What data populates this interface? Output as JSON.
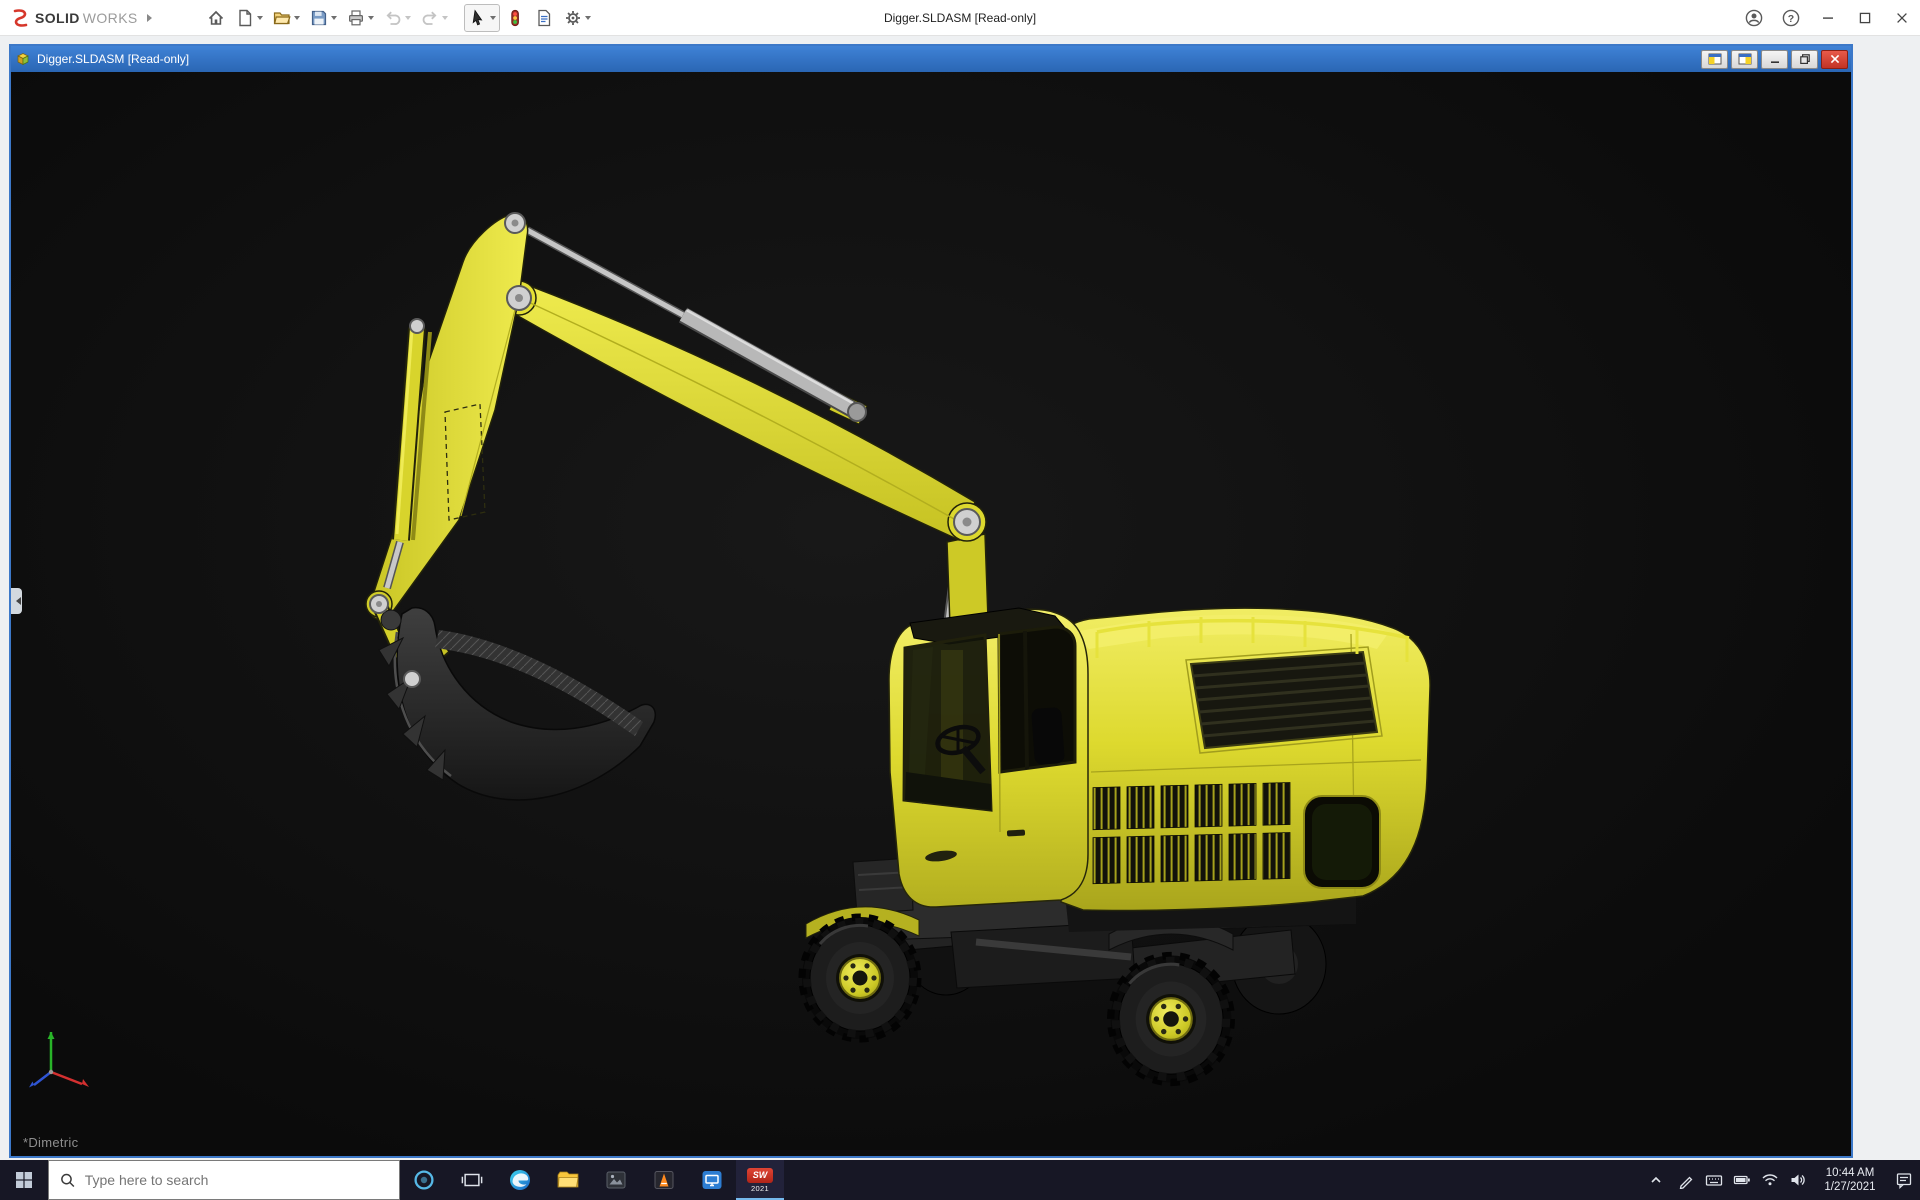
{
  "colors": {
    "excavator_yellow": "#e0dc31",
    "doc_titlebar_blue": "#2f6fc4",
    "viewport_background": "#0d0d0d",
    "taskbar_background": "#171725",
    "close_button_red": "#d0392b"
  },
  "app_titlebar": {
    "window_title": "Digger.SLDASM [Read-only]",
    "brand": {
      "solid": "SOLID",
      "works": "WORKS"
    },
    "help_glyph": "?",
    "toolbar_icon_names": [
      "home",
      "new-document",
      "open",
      "save",
      "print",
      "undo",
      "redo",
      "select-arrow",
      "rebuild",
      "file-properties",
      "options"
    ],
    "window_control_names": [
      "account",
      "help",
      "minimize",
      "maximize",
      "close"
    ]
  },
  "document_window": {
    "title": "Digger.SLDASM [Read-only]",
    "view_orientation_label": "*Dimetric",
    "window_control_names": [
      "pane-left",
      "pane-right",
      "minimize",
      "restore",
      "close"
    ]
  },
  "taskbar": {
    "search_placeholder": "Type here to search",
    "pinned_icon_names": [
      "start",
      "cortana",
      "task-view",
      "edge",
      "file-explorer",
      "photos",
      "media-player",
      "display",
      "solidworks"
    ],
    "tray_icon_names": [
      "hidden-icons",
      "pen",
      "touch-keyboard",
      "battery",
      "network",
      "volume",
      "action-center"
    ],
    "solidworks_icon": {
      "letters": "SW",
      "year": "2021"
    },
    "clock": {
      "time": "10:44 AM",
      "date": "1/27/2021"
    }
  }
}
